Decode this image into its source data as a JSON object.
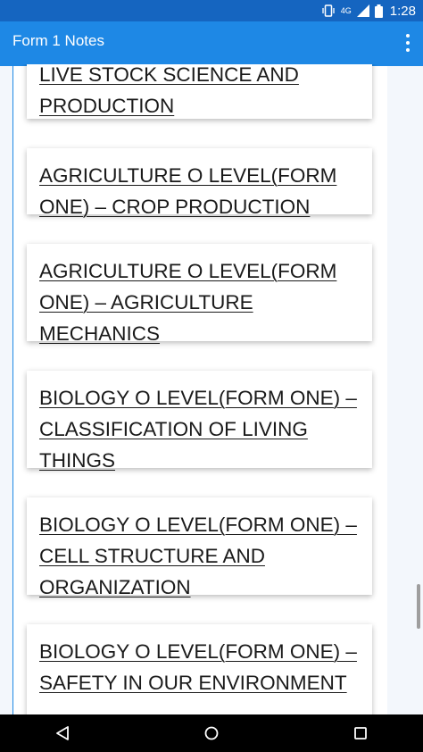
{
  "status_bar": {
    "network_label": "4G",
    "time": "1:28",
    "icons": [
      "vibrate-icon",
      "signal-icon",
      "battery-icon"
    ]
  },
  "app_bar": {
    "title": "Form 1 Notes",
    "menu_icon": "more-vert-icon"
  },
  "cards": [
    {
      "title": "LIVE STOCK SCIENCE AND PRODUCTION"
    },
    {
      "title": "AGRICULTURE O LEVEL(FORM ONE) – CROP PRODUCTION"
    },
    {
      "title": "AGRICULTURE O LEVEL(FORM ONE) – AGRICULTURE MECHANICS"
    },
    {
      "title": "BIOLOGY O LEVEL(FORM ONE) – CLASSIFICATION OF LIVING THINGS"
    },
    {
      "title": "BIOLOGY O LEVEL(FORM ONE) – CELL STRUCTURE AND ORGANIZATION"
    },
    {
      "title": "BIOLOGY O LEVEL(FORM ONE) – SAFETY IN OUR ENVIRONMENT"
    }
  ],
  "nav_bar": {
    "icons": [
      "back-icon",
      "home-icon",
      "recents-icon"
    ]
  },
  "colors": {
    "status_bar": "#1565c0",
    "app_bar": "#1e88e5",
    "frame_background": "#f3f7fc"
  }
}
